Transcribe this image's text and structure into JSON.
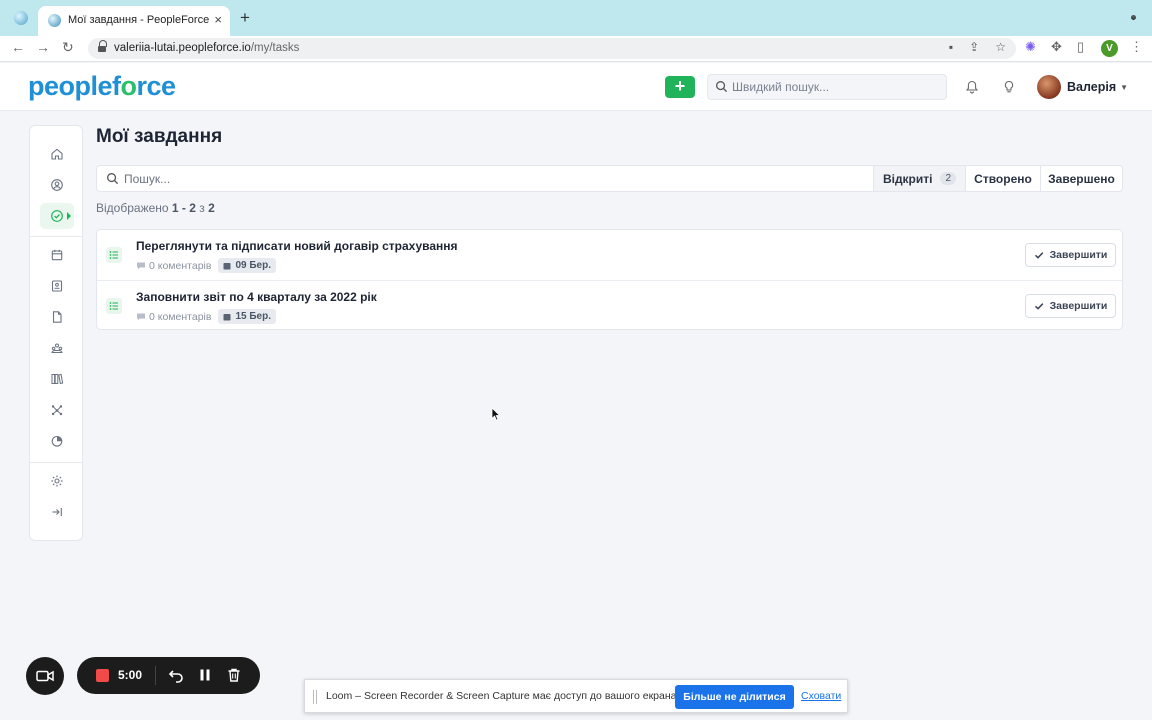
{
  "browser": {
    "tab_title": "Мої завдання - PeopleForce",
    "url_host": "valeriia-lutai.peopleforce.io",
    "url_path": "/my/tasks",
    "profile_initial": "V"
  },
  "header": {
    "logo_part1": "peoplef",
    "logo_part2": "o",
    "logo_part3": "rce",
    "add_label": "+",
    "search_placeholder": "Швидкий пошук...",
    "user_name": "Валерія"
  },
  "sidebar": {
    "items": [
      {
        "icon": "home-icon"
      },
      {
        "icon": "user-circle-icon"
      },
      {
        "icon": "check-circle-icon",
        "active": true
      },
      {
        "icon": "calendar-icon"
      },
      {
        "icon": "id-card-icon"
      },
      {
        "icon": "document-icon"
      },
      {
        "icon": "people-icon"
      },
      {
        "icon": "books-icon"
      },
      {
        "icon": "network-icon"
      },
      {
        "icon": "pie-chart-icon"
      },
      {
        "icon": "settings-icon"
      },
      {
        "icon": "collapse-icon"
      }
    ]
  },
  "page": {
    "title": "Мої завдання",
    "search_placeholder": "Пошук...",
    "filters": [
      {
        "label": "Відкриті",
        "count": "2",
        "active": true
      },
      {
        "label": "Створено"
      },
      {
        "label": "Завершено"
      }
    ],
    "showing_prefix": "Відображено",
    "showing_range": "1 - 2",
    "showing_of": "з",
    "showing_total": "2"
  },
  "tasks": [
    {
      "title": "Переглянути та підписати новий догавір страхування",
      "comments": "0 коментарів",
      "due": "09 Бер.",
      "action": "Завершити"
    },
    {
      "title": "Заповнити звіт по 4 кварталу за 2022 рік",
      "comments": "0 коментарів",
      "due": "15 Бер.",
      "action": "Завершити"
    }
  ],
  "loom": {
    "timer": "5:00",
    "notice": "Loom – Screen Recorder & Screen Capture має доступ до вашого екрана.",
    "stop_sharing": "Більше не ділитися",
    "hide": "Сховати"
  },
  "colors": {
    "brand_green": "#21b35a",
    "brand_blue": "#1f8fd6",
    "record_red": "#f04b48",
    "link_blue": "#1a73e8"
  }
}
